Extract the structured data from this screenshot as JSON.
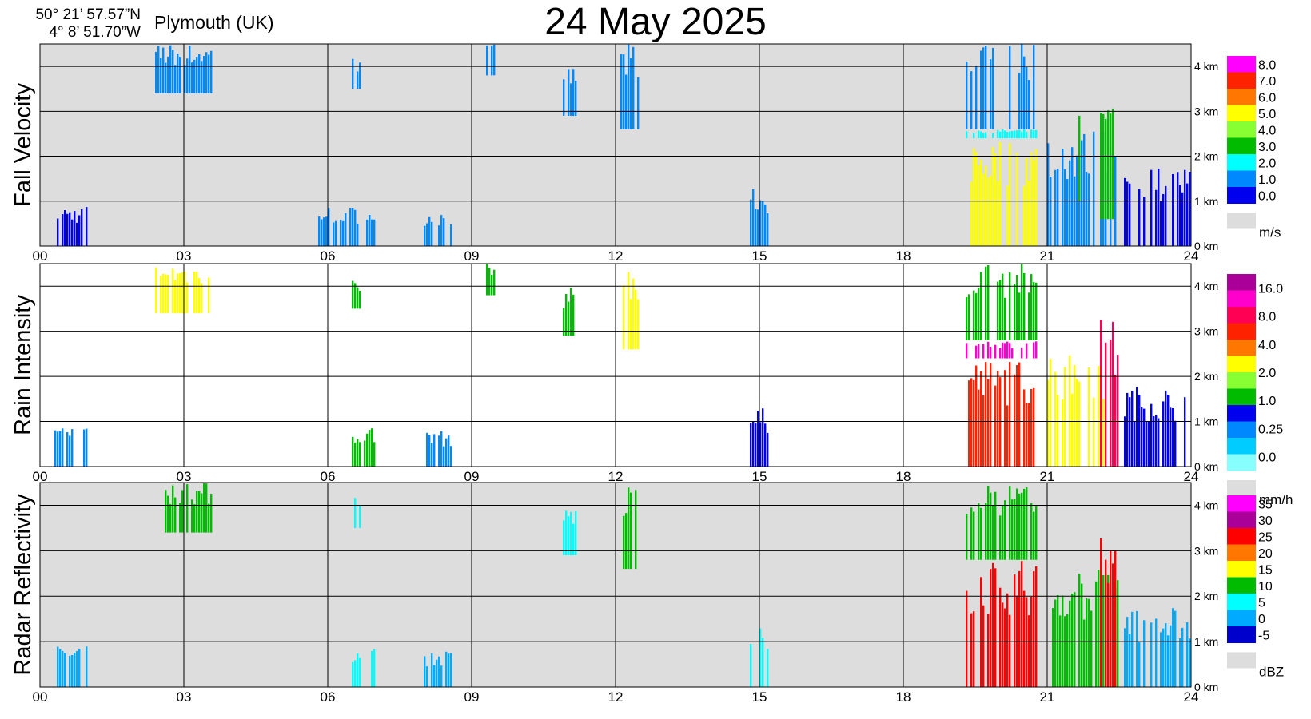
{
  "header": {
    "latitude": "50° 21’ 57.57”N",
    "longitude": "4°  8’ 51.70”W",
    "location": "Plymouth (UK)",
    "title": "24 May  2025"
  },
  "colors": {
    "no_data_background": "#dddddd",
    "grid": "#000000"
  },
  "chart_data": [
    {
      "type": "heatmap",
      "ylabel": "Fall Velocity",
      "xlabel": "",
      "x_ticks": [
        "00",
        "03",
        "06",
        "09",
        "12",
        "15",
        "18",
        "21",
        "24"
      ],
      "x_range_hours": [
        0,
        24
      ],
      "y_ticks": [
        "0 km",
        "1 km",
        "2 km",
        "3 km",
        "4 km"
      ],
      "y_range_km": [
        0,
        4.5
      ],
      "background": "grey",
      "legend": {
        "unit": "m/s",
        "labels": [
          "8.0",
          "7.0",
          "6.0",
          "5.0",
          "4.0",
          "3.0",
          "2.0",
          "1.0",
          "0.0"
        ],
        "colors": [
          "#ff00ff",
          "#ff2200",
          "#ff7700",
          "#ffff00",
          "#88ff33",
          "#00bb00",
          "#00ffff",
          "#0088ff",
          "#0000ee"
        ]
      },
      "echoes": [
        {
          "t0": 0.3,
          "t1": 1.0,
          "z0": 0.0,
          "z1": 0.9,
          "level": 0.5
        },
        {
          "t0": 2.4,
          "t1": 3.6,
          "z0": 3.4,
          "z1": 4.5,
          "level": 1.2
        },
        {
          "t0": 5.8,
          "t1": 7.0,
          "z0": 0.0,
          "z1": 0.9,
          "level": 0.7
        },
        {
          "t0": 6.5,
          "t1": 6.7,
          "z0": 3.5,
          "z1": 4.2,
          "level": 1.0
        },
        {
          "t0": 8.0,
          "t1": 8.6,
          "z0": 0.0,
          "z1": 0.8,
          "level": 1.0
        },
        {
          "t0": 9.3,
          "t1": 9.5,
          "z0": 3.8,
          "z1": 4.5,
          "level": 0.8
        },
        {
          "t0": 10.9,
          "t1": 11.2,
          "z0": 2.9,
          "z1": 4.0,
          "level": 0.8
        },
        {
          "t0": 12.1,
          "t1": 12.5,
          "z0": 2.6,
          "z1": 4.5,
          "level": 1.3
        },
        {
          "t0": 14.8,
          "t1": 15.2,
          "z0": 0.0,
          "z1": 1.3,
          "level": 0.6
        },
        {
          "t0": 19.3,
          "t1": 20.8,
          "z0": 2.6,
          "z1": 4.5,
          "level": 0.6
        },
        {
          "t0": 19.3,
          "t1": 20.8,
          "z0": 2.4,
          "z1": 2.6,
          "level": 2.5
        },
        {
          "t0": 19.3,
          "t1": 20.8,
          "z0": 0.0,
          "z1": 2.4,
          "level": 5.0
        },
        {
          "t0": 21.0,
          "t1": 22.5,
          "z0": 0.0,
          "z1": 2.6,
          "level": 1.5
        },
        {
          "t0": 21.5,
          "t1": 21.7,
          "z0": 1.0,
          "z1": 3.5,
          "level": 3.5
        },
        {
          "t0": 22.1,
          "t1": 22.5,
          "z0": 0.6,
          "z1": 3.3,
          "level": 3.0
        },
        {
          "t0": 22.6,
          "t1": 24.0,
          "z0": 0.0,
          "z1": 1.8,
          "level": 0.5
        }
      ]
    },
    {
      "type": "heatmap",
      "ylabel": "Rain Intensity",
      "xlabel": "",
      "x_ticks": [
        "00",
        "03",
        "06",
        "09",
        "12",
        "15",
        "18",
        "21",
        "24"
      ],
      "x_range_hours": [
        0,
        24
      ],
      "y_ticks": [
        "0 km",
        "1 km",
        "2 km",
        "3 km",
        "4 km"
      ],
      "y_range_km": [
        0,
        4.5
      ],
      "background": "white",
      "legend": {
        "unit": "mm/h",
        "labels": [
          "16.0",
          "8.0",
          "4.0",
          "2.0",
          "1.0",
          "0.25",
          "0.0"
        ],
        "colors": [
          "#aa0099",
          "#ff00cc",
          "#ff0055",
          "#ff2200",
          "#ff7700",
          "#ffff00",
          "#88ff33",
          "#00bb00",
          "#0000ee",
          "#0088ff",
          "#00ccff",
          "#88ffff"
        ]
      },
      "echoes": [
        {
          "t0": 0.3,
          "t1": 1.0,
          "z0": 0.0,
          "z1": 0.9,
          "level": 0.05
        },
        {
          "t0": 2.4,
          "t1": 3.6,
          "z0": 3.4,
          "z1": 4.5,
          "level": 0.6
        },
        {
          "t0": 6.5,
          "t1": 7.0,
          "z0": 0.0,
          "z1": 0.9,
          "level": 0.3
        },
        {
          "t0": 6.5,
          "t1": 6.7,
          "z0": 3.5,
          "z1": 4.2,
          "level": 0.2
        },
        {
          "t0": 8.0,
          "t1": 8.6,
          "z0": 0.0,
          "z1": 0.8,
          "level": 0.05
        },
        {
          "t0": 9.3,
          "t1": 9.5,
          "z0": 3.8,
          "z1": 4.5,
          "level": 0.2
        },
        {
          "t0": 10.9,
          "t1": 11.2,
          "z0": 2.9,
          "z1": 4.0,
          "level": 0.2
        },
        {
          "t0": 12.1,
          "t1": 12.5,
          "z0": 2.6,
          "z1": 4.5,
          "level": 0.8
        },
        {
          "t0": 14.8,
          "t1": 15.2,
          "z0": 0.0,
          "z1": 1.3,
          "level": 0.1
        },
        {
          "t0": 19.3,
          "t1": 20.8,
          "z0": 2.8,
          "z1": 4.5,
          "level": 0.3
        },
        {
          "t0": 19.3,
          "t1": 20.8,
          "z0": 2.4,
          "z1": 2.8,
          "level": 8.0
        },
        {
          "t0": 19.3,
          "t1": 20.8,
          "z0": 0.0,
          "z1": 2.4,
          "level": 3.0
        },
        {
          "t0": 21.0,
          "t1": 22.5,
          "z0": 0.0,
          "z1": 2.6,
          "level": 0.8
        },
        {
          "t0": 22.1,
          "t1": 22.5,
          "z0": 0.0,
          "z1": 3.3,
          "level": 6.0
        },
        {
          "t0": 22.6,
          "t1": 24.0,
          "z0": 0.0,
          "z1": 1.8,
          "level": 0.1
        }
      ]
    },
    {
      "type": "heatmap",
      "ylabel": "Radar Reflectivity",
      "xlabel": "",
      "x_ticks": [
        "00",
        "03",
        "06",
        "09",
        "12",
        "15",
        "18",
        "21",
        "24"
      ],
      "x_range_hours": [
        0,
        24
      ],
      "y_ticks": [
        "0 km",
        "1 km",
        "2 km",
        "3 km",
        "4 km"
      ],
      "y_range_km": [
        0,
        4.5
      ],
      "background": "grey",
      "legend": {
        "unit": "dBZ",
        "labels": [
          "35",
          "30",
          "25",
          "20",
          "15",
          "10",
          "5",
          "0",
          "-5"
        ],
        "colors": [
          "#ff00ff",
          "#aa0099",
          "#ff0000",
          "#ff7700",
          "#ffff00",
          "#00bb00",
          "#00ffff",
          "#00aaff",
          "#0000cc"
        ]
      },
      "echoes": [
        {
          "t0": 0.3,
          "t1": 1.0,
          "z0": 0.0,
          "z1": 0.9,
          "level": 0
        },
        {
          "t0": 2.4,
          "t1": 3.6,
          "z0": 3.4,
          "z1": 4.5,
          "level": 10
        },
        {
          "t0": 6.5,
          "t1": 7.0,
          "z0": 0.0,
          "z1": 0.9,
          "level": 5
        },
        {
          "t0": 6.5,
          "t1": 6.7,
          "z0": 3.5,
          "z1": 4.2,
          "level": 5
        },
        {
          "t0": 8.0,
          "t1": 8.6,
          "z0": 0.0,
          "z1": 0.8,
          "level": 0
        },
        {
          "t0": 10.9,
          "t1": 11.2,
          "z0": 2.9,
          "z1": 4.0,
          "level": 5
        },
        {
          "t0": 12.1,
          "t1": 12.5,
          "z0": 2.6,
          "z1": 4.5,
          "level": 12
        },
        {
          "t0": 14.8,
          "t1": 15.2,
          "z0": 0.0,
          "z1": 1.3,
          "level": 5
        },
        {
          "t0": 19.3,
          "t1": 20.8,
          "z0": 2.8,
          "z1": 4.5,
          "level": 10
        },
        {
          "t0": 19.3,
          "t1": 20.8,
          "z0": 0.0,
          "z1": 2.8,
          "level": 27
        },
        {
          "t0": 21.0,
          "t1": 22.5,
          "z0": 0.0,
          "z1": 2.6,
          "level": 12
        },
        {
          "t0": 22.1,
          "t1": 22.5,
          "z0": 0.0,
          "z1": 3.3,
          "level": 25
        },
        {
          "t0": 22.6,
          "t1": 24.0,
          "z0": 0.0,
          "z1": 1.8,
          "level": 2
        }
      ]
    }
  ]
}
